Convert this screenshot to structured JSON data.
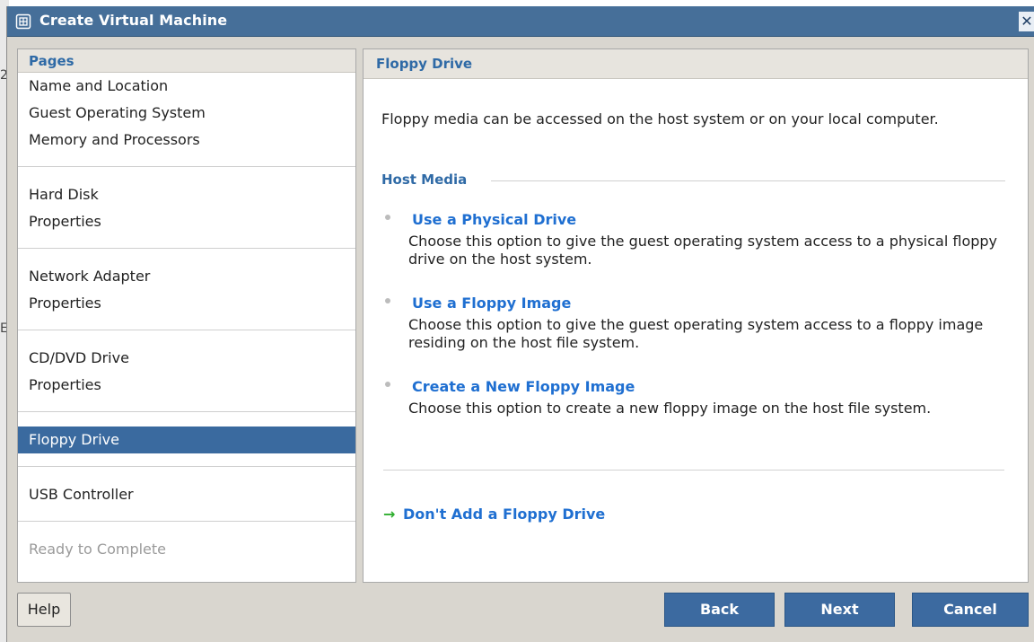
{
  "background": {
    "marks": [
      "2",
      "E"
    ]
  },
  "window": {
    "title": "Create Virtual Machine",
    "close_label": "✕"
  },
  "pages": {
    "header": "Pages",
    "groups": [
      {
        "items": [
          "Name and Location",
          "Guest Operating System",
          "Memory and Processors"
        ]
      },
      {
        "items": [
          "Hard Disk",
          "Properties"
        ]
      },
      {
        "items": [
          "Network Adapter",
          "Properties"
        ]
      },
      {
        "items": [
          "CD/DVD Drive",
          "Properties"
        ]
      },
      {
        "items": [
          "Floppy Drive"
        ],
        "selected_index": 0
      },
      {
        "items": [
          "USB Controller"
        ]
      },
      {
        "items": [
          "Ready to Complete"
        ],
        "disabled": true
      }
    ]
  },
  "content": {
    "header": "Floppy Drive",
    "intro": "Floppy media can be accessed on the host system or on your local computer.",
    "section_title": "Host Media",
    "options": [
      {
        "title": "Use a Physical Drive",
        "description": "Choose this option to give the guest operating system access to a physical floppy drive on the host system."
      },
      {
        "title": "Use a Floppy Image",
        "description": "Choose this option to give the guest operating system access to a floppy image residing on the host file system."
      },
      {
        "title": "Create a New Floppy Image",
        "description": "Choose this option to create a new floppy image on the host file system."
      }
    ],
    "skip_label": "Don't Add a Floppy Drive",
    "skip_arrow": "→"
  },
  "buttons": {
    "help": "Help",
    "back": "Back",
    "next": "Next",
    "cancel": "Cancel"
  },
  "colors": {
    "titlebar": "#466f99",
    "selected": "#3a6a9f",
    "link": "#1f6fd1",
    "header_text": "#2f6aa6",
    "primary_button": "#3c6aa0",
    "arrow": "#2fae2f"
  }
}
